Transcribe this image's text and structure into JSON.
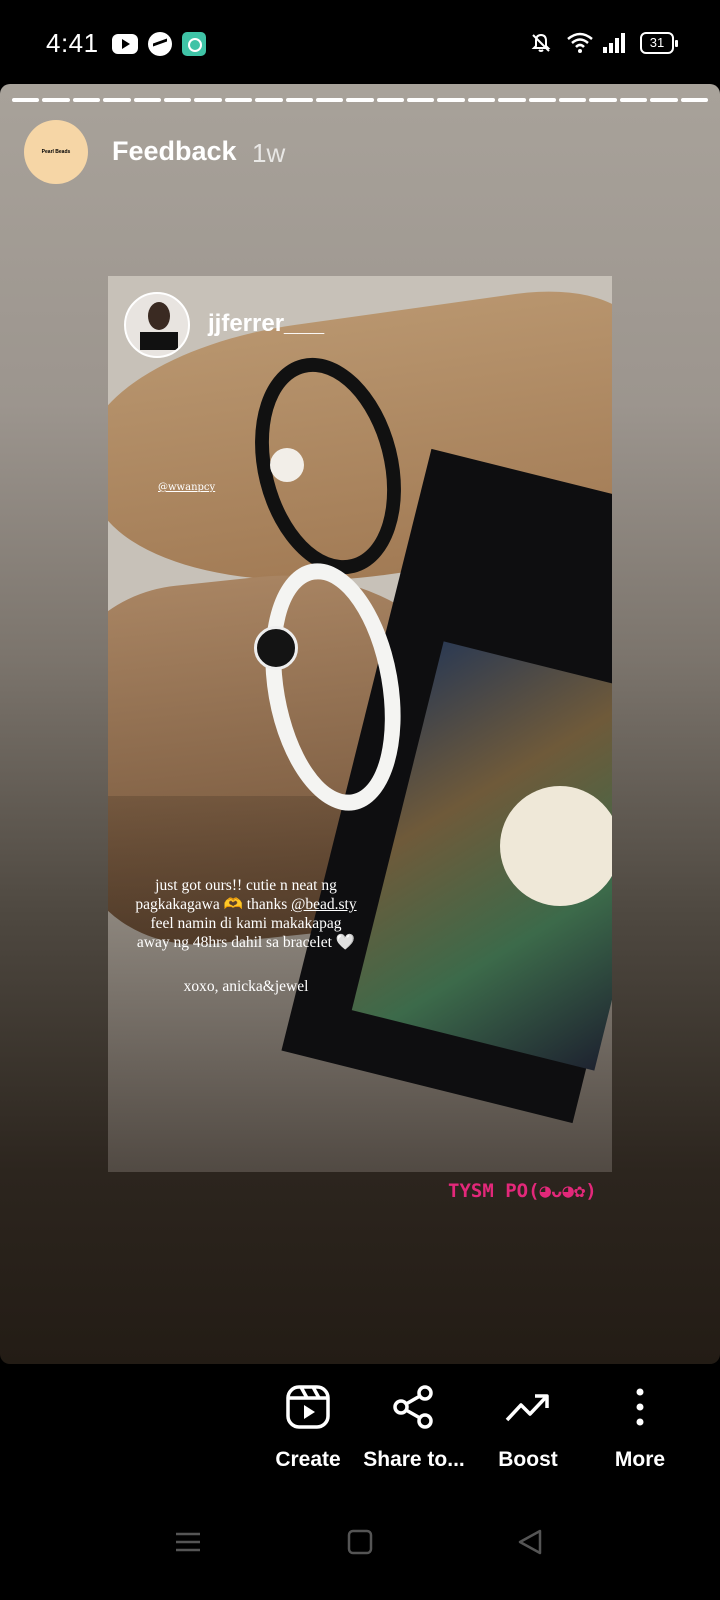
{
  "status_bar": {
    "time": "4:41",
    "battery": "31",
    "app_icons": [
      "youtube-icon",
      "messenger-icon",
      "app-icon"
    ],
    "system_icons": [
      "mute-icon",
      "wifi-icon",
      "signal-icon",
      "battery-icon"
    ]
  },
  "story": {
    "account_name": "Feedback",
    "time_ago": "1w",
    "avatar_text": "Pearl Beads",
    "progress": {
      "segments": 23,
      "current": 23
    },
    "repost": {
      "username": "jjferrer___",
      "tag": "@wwanpcy",
      "caption_line1": "just got ours!! cutie n neat ng",
      "caption_line2a": "pagkakagawa 🫶 thanks ",
      "caption_mention": "@bead.sty",
      "caption_line3": "feel namin di kami makakapag",
      "caption_line4": "away ng 48hrs dahil sa bracelet 🤍",
      "signoff": "xoxo, anicka&jewel"
    },
    "sticker_text": "TYSM PO(◕ᴗ◕✿)",
    "sticker_color": "#e3287a"
  },
  "actions": {
    "create": "Create",
    "share": "Share to...",
    "boost": "Boost",
    "more": "More"
  },
  "navbar": {
    "icons": [
      "menu-icon",
      "home-icon",
      "back-icon"
    ]
  }
}
